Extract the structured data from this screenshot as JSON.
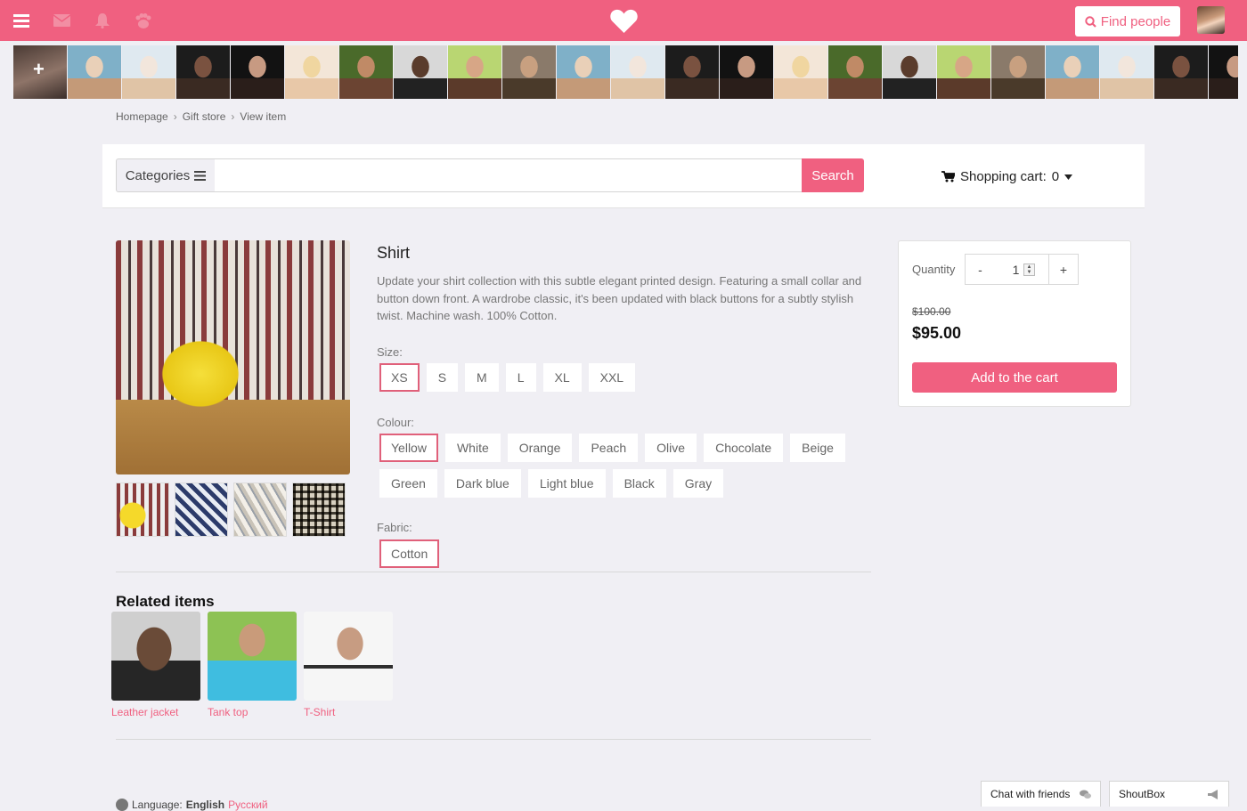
{
  "header": {
    "menu_icon": "hamburger-icon",
    "mail_icon": "envelope-icon",
    "bell_icon": "bell-icon",
    "friends_icon": "paw-icon",
    "logo_icon": "heart-icon",
    "find_people_label": "Find people",
    "brand_color": "#f06080"
  },
  "strip": {
    "add_icon": "plus-icon",
    "count": 23
  },
  "breadcrumb": [
    "Homepage",
    "Gift store",
    "View item"
  ],
  "search": {
    "categories_label": "Categories",
    "placeholder": "",
    "button_label": "Search"
  },
  "cart": {
    "label": "Shopping cart:",
    "count": "0"
  },
  "product": {
    "title": "Shirt",
    "description": "Update your shirt collection with this subtle elegant printed design. Featuring a small collar and button down front. A wardrobe classic, it's been updated with black buttons for a subtly stylish twist. Machine wash. 100% Cotton.",
    "size_label": "Size:",
    "sizes": [
      "XS",
      "S",
      "M",
      "L",
      "XL",
      "XXL"
    ],
    "selected_size": "XS",
    "colour_label": "Colour:",
    "colours": [
      "Yellow",
      "White",
      "Orange",
      "Peach",
      "Olive",
      "Chocolate",
      "Beige",
      "Green",
      "Dark blue",
      "Light blue",
      "Black",
      "Gray"
    ],
    "selected_colour": "Yellow",
    "fabric_label": "Fabric:",
    "fabrics": [
      "Cotton"
    ],
    "selected_fabric": "Cotton"
  },
  "buy": {
    "quantity_label": "Quantity",
    "minus_label": "-",
    "plus_label": "+",
    "quantity": "1",
    "old_price": "$100.00",
    "price": "$95.00",
    "add_label": "Add to the cart"
  },
  "related": {
    "title": "Related items",
    "items": [
      "Leather jacket",
      "Tank top",
      "T-Shirt"
    ]
  },
  "footer": {
    "language_label": "Language:",
    "lang_current": "English",
    "lang_other": "Русский"
  },
  "chat": {
    "friends_label": "Chat with friends",
    "shoutbox_label": "ShoutBox"
  }
}
